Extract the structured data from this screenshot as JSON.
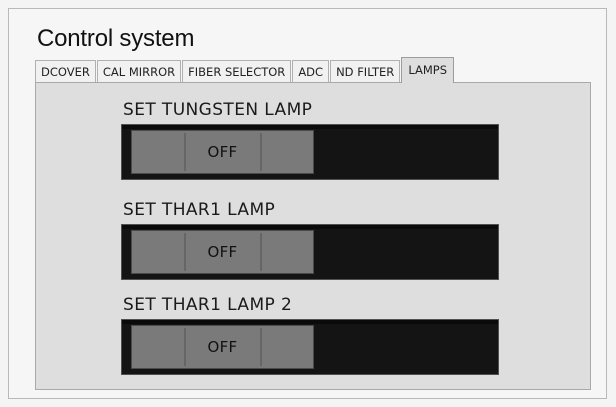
{
  "app": {
    "title": "Control system"
  },
  "tabs": [
    {
      "label": "DCOVER",
      "active": false
    },
    {
      "label": "CAL MIRROR",
      "active": false
    },
    {
      "label": "FIBER SELECTOR",
      "active": false
    },
    {
      "label": "ADC",
      "active": false
    },
    {
      "label": "ND FILTER",
      "active": false
    },
    {
      "label": "LAMPS",
      "active": true
    }
  ],
  "lamps": [
    {
      "label": "SET TUNGSTEN LAMP",
      "state": "OFF"
    },
    {
      "label": "SET THAR1 LAMP",
      "state": "OFF"
    },
    {
      "label": "SET THAR1 LAMP 2",
      "state": "OFF"
    }
  ]
}
